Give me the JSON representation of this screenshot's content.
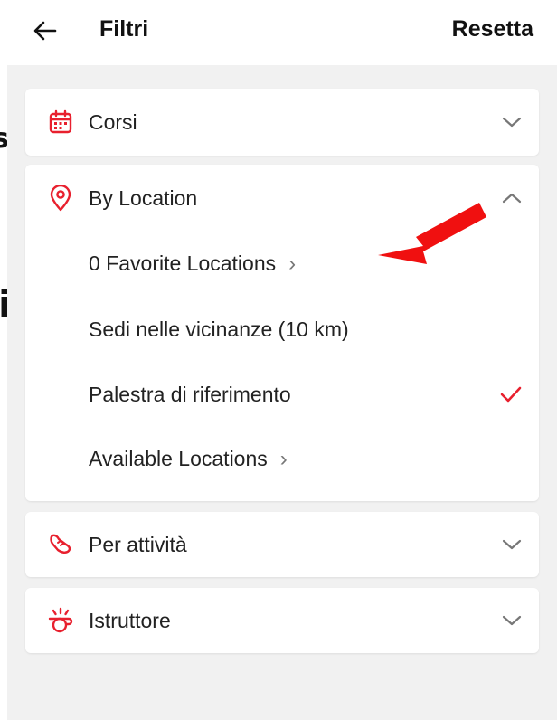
{
  "header": {
    "title": "Filtri",
    "reset_label": "Resetta",
    "back_icon": "arrow-left-icon"
  },
  "colors": {
    "accent": "#e8202e",
    "annotation_arrow": "#f01010",
    "background": "#f1f1f1"
  },
  "filters": {
    "courses": {
      "label": "Corsi",
      "icon": "calendar-icon",
      "expanded": false
    },
    "location": {
      "label": "By Location",
      "icon": "map-pin-icon",
      "expanded": true,
      "options": [
        {
          "label": "0 Favorite Locations",
          "has_arrow": true,
          "selected": false
        },
        {
          "label": "Sedi nelle vicinanze (10 km)",
          "has_arrow": false,
          "selected": false
        },
        {
          "label": "Palestra di riferimento",
          "has_arrow": false,
          "selected": true
        },
        {
          "label": "Available Locations",
          "has_arrow": true,
          "selected": false
        }
      ]
    },
    "activity": {
      "label": "Per attività",
      "icon": "sneaker-icon",
      "expanded": false
    },
    "instructor": {
      "label": "Istruttore",
      "icon": "whistle-icon",
      "expanded": false
    }
  },
  "edge_fragments": {
    "top": "s",
    "bottom": "i"
  }
}
